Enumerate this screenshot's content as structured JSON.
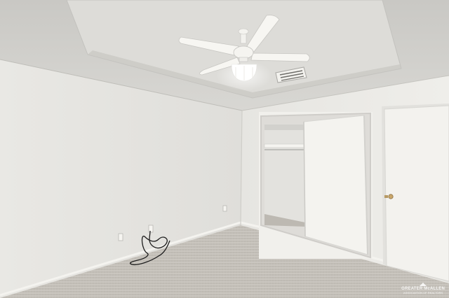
{
  "watermark": {
    "brand": "GREATER McALLEN",
    "subtitle": "ASSOCIATION OF REALTORS"
  }
}
